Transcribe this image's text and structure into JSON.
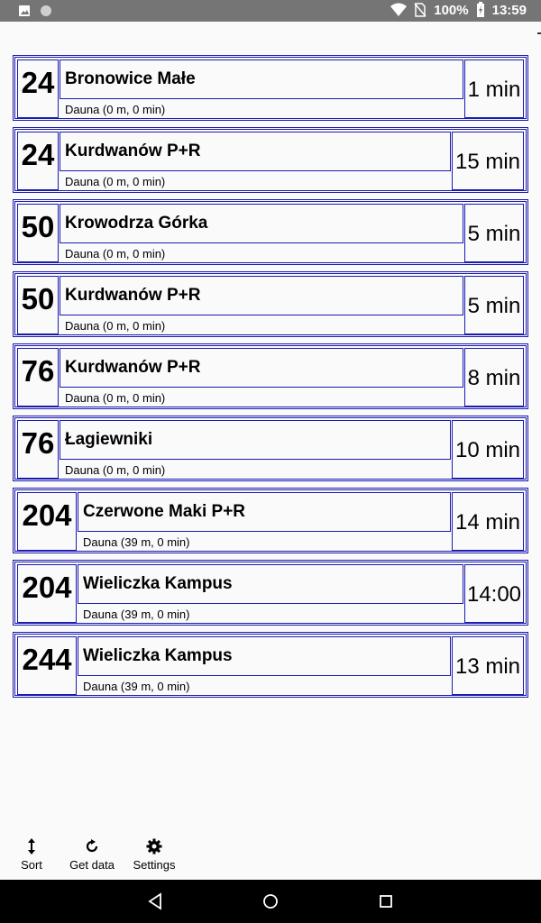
{
  "status_bar": {
    "battery": "100%",
    "time": "13:59",
    "icons": [
      "image-icon",
      "circle-icon",
      "wifi-icon",
      "no-sim-icon",
      "battery-charging-icon"
    ]
  },
  "departures": [
    {
      "line": "24",
      "destination": "Bronowice Małe",
      "stop_info": "Dauna (0 m, 0 min)",
      "time": "1 min"
    },
    {
      "line": "24",
      "destination": "Kurdwanów P+R",
      "stop_info": "Dauna (0 m, 0 min)",
      "time": "15 min"
    },
    {
      "line": "50",
      "destination": "Krowodrza Górka",
      "stop_info": "Dauna (0 m, 0 min)",
      "time": "5 min"
    },
    {
      "line": "50",
      "destination": "Kurdwanów P+R",
      "stop_info": "Dauna (0 m, 0 min)",
      "time": "5 min"
    },
    {
      "line": "76",
      "destination": "Kurdwanów P+R",
      "stop_info": "Dauna (0 m, 0 min)",
      "time": "8 min"
    },
    {
      "line": "76",
      "destination": "Łagiewniki",
      "stop_info": "Dauna (0 m, 0 min)",
      "time": "10 min"
    },
    {
      "line": "204",
      "destination": "Czerwone Maki P+R",
      "stop_info": "Dauna (39 m, 0 min)",
      "time": "14 min"
    },
    {
      "line": "204",
      "destination": "Wieliczka Kampus",
      "stop_info": "Dauna (39 m, 0 min)",
      "time": "14:00"
    },
    {
      "line": "244",
      "destination": "Wieliczka Kampus",
      "stop_info": "Dauna (39 m, 0 min)",
      "time": "13 min"
    }
  ],
  "toolbar": {
    "sort_label": "Sort",
    "sort_icon": "sort-arrows-icon",
    "get_data_label": "Get data",
    "get_data_icon": "refresh-icon",
    "settings_label": "Settings",
    "settings_icon": "gear-icon"
  },
  "nav": {
    "icons": [
      "back-icon",
      "home-icon",
      "recents-icon"
    ]
  },
  "colors": {
    "border": "#1a1ab0",
    "status_bar": "#757575",
    "nav_bar": "#000000"
  }
}
